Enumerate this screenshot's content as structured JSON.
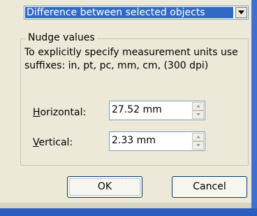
{
  "dropdown": {
    "selected": "Difference between selected objects"
  },
  "nudge": {
    "title": "Nudge values",
    "help_text": "To explicitly specify measurement units use suffixes: in, pt, pc, mm, cm, (300 dpi)",
    "horizontal": {
      "mnemonic": "H",
      "label_rest": "orizontal:",
      "value": "27.52 mm"
    },
    "vertical": {
      "mnemonic": "V",
      "label_rest": "ertical:",
      "value": "2.33 mm"
    }
  },
  "buttons": {
    "ok": "OK",
    "cancel": "Cancel"
  },
  "icons": {
    "dropdown": "chevron-down-icon",
    "spin_up": "spin-up-arrow-icon",
    "spin_down": "spin-down-arrow-icon"
  },
  "colors": {
    "selection": "#316ac5",
    "dialog_bg": "#ece9d8",
    "window_frame": "#2b5fbe"
  }
}
